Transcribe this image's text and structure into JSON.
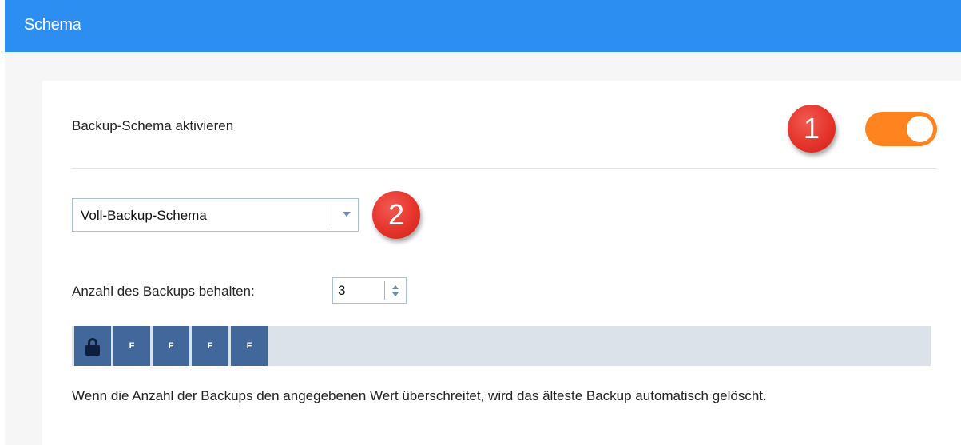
{
  "window": {
    "title": "Schema"
  },
  "scheme": {
    "activate_label": "Backup-Schema aktivieren",
    "toggle_on": true,
    "select_value": "Voll-Backup-Schema",
    "keep_label": "Anzahl des Backups behalten:",
    "keep_count": "3",
    "slots": [
      "F",
      "F",
      "F",
      "F"
    ],
    "info": "Wenn die Anzahl der Backups den angegebenen Wert überschreitet, wird das älteste Backup automatisch gelöscht."
  },
  "annotations": {
    "badge1": "1",
    "badge2": "2"
  },
  "colors": {
    "header": "#2d8ef2",
    "toggle": "#ff8420",
    "slot": "#41679b",
    "badge": "#e5342b"
  }
}
